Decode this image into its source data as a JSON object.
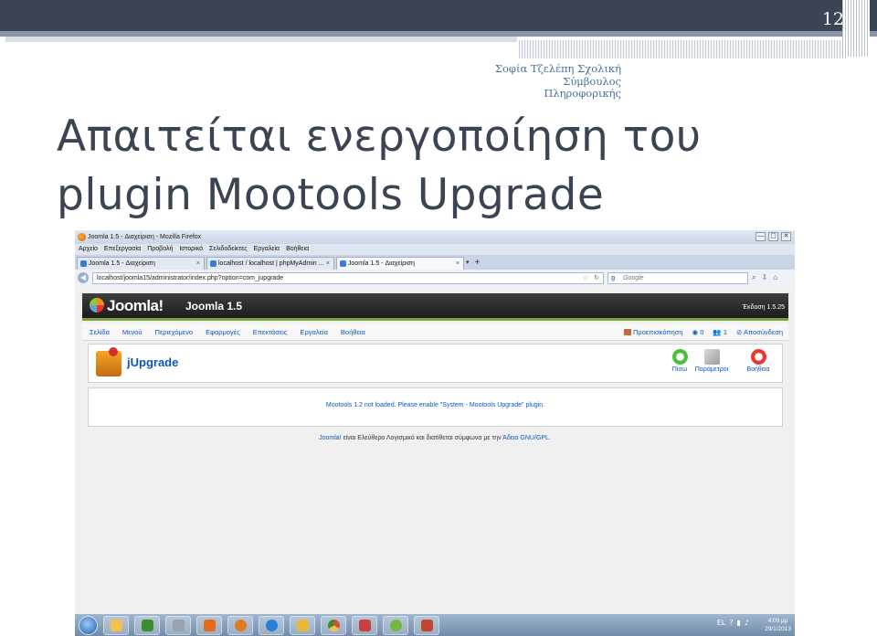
{
  "slide": {
    "number": "12",
    "author_line1": "Σοφία Τζελέπη Σχολική",
    "author_line2": "Σύμβουλος",
    "author_line3": "Πληροφορικής",
    "title_line1": "Απαιτείται ενεργοποίηση του",
    "title_line2": "plugin Mootools Upgrade"
  },
  "browser": {
    "window_title": "Joomla 1.5 - Διαχείριση - Mozilla Firefox",
    "window_buttons": [
      "—",
      "▢",
      "✕"
    ],
    "menu": [
      "Αρχείο",
      "Επεξεργασία",
      "Προβολή",
      "Ιστορικό",
      "Σελιδοδείκτες",
      "Εργαλεία",
      "Βοήθεια"
    ],
    "tabs": [
      {
        "label": "Joomla 1.5 - Διαχείριση"
      },
      {
        "label": "localhost / localhost | phpMyAdmin ..."
      },
      {
        "label": "Joomla 1.5 - Διαχείριση"
      }
    ],
    "tab_plus": "+",
    "url": "localhost/joomla15/administrator/index.php?option=com_jupgrade",
    "search_placeholder": "Google"
  },
  "joomla": {
    "logo_text": "Joomla!",
    "site_name": "Joomla 1.5",
    "version": "Έκδοση 1.5.25",
    "menu": [
      "Σελίδα",
      "Μενού",
      "Περιεχόμενο",
      "Εφαρμογές",
      "Επεκτάσεις",
      "Εργαλεία",
      "Βοήθεια"
    ],
    "preview": "Προεπισκόπηση",
    "messages_count": "0",
    "users_count": "1",
    "logout": "Αποσύνδεση",
    "component_title": "jUpgrade",
    "toolbar": {
      "back": "Πίσω",
      "params": "Παράμετροι",
      "help": "Βοήθεια"
    },
    "message": "Mootools 1.2 not loaded. Please enable \"System - Mootools Upgrade\" plugin.",
    "footer_link": "Joomla!",
    "footer_text": " είναι Ελεύθερο Λογισμικό και διατίθεται σύμφωνα με την ",
    "footer_license": "Άδεια GNU/GPL."
  },
  "taskbar": {
    "lang": "EL",
    "time": "4:09 μμ",
    "date": "29/1/2013",
    "app_colors": [
      "#f2c14e",
      "#3c8d2f",
      "#9aa3ad",
      "#e36b1b",
      "#2a7fd4",
      "#e9b83a",
      "#d94c3a",
      "#c94040",
      "#74b843",
      "#c2452d"
    ]
  },
  "colors": {
    "slide_header": "#3b4452",
    "accent_text": "#4a6f9a",
    "joomla_link": "#0b55c4",
    "joomla_green": "#7da23a"
  }
}
